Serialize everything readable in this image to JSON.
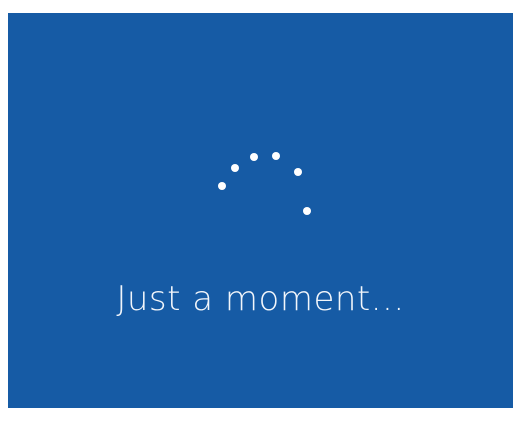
{
  "screen": {
    "message": "Just a moment...",
    "background_color": "#165ba5",
    "spinner_color": "#ffffff",
    "spinner_icon": "loading-dots-icon"
  }
}
